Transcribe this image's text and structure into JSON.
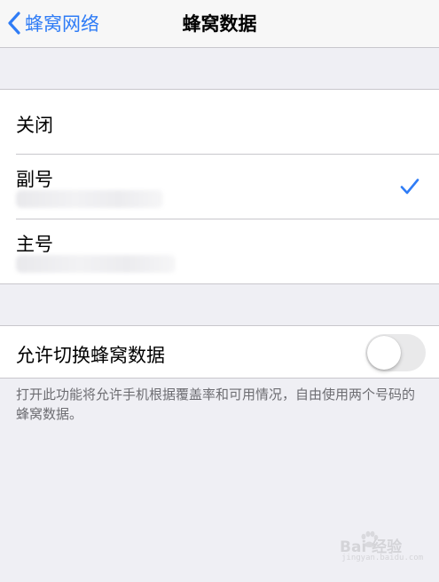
{
  "nav": {
    "back_label": "蜂窝网络",
    "title": "蜂窝数据"
  },
  "options": [
    {
      "label": "关闭",
      "selected": false
    },
    {
      "label": "副号",
      "selected": true
    },
    {
      "label": "主号",
      "selected": false
    }
  ],
  "toggle": {
    "label": "允许切换蜂窝数据",
    "on": false
  },
  "footnote": "打开此功能将允许手机根据覆盖率和可用情况，自由使用两个号码的蜂窝数据。",
  "watermark": {
    "text": "Bai 经验",
    "sub": "jingyan.baidu.com"
  },
  "colors": {
    "accent": "#2f7cf6",
    "background": "#efeff4",
    "separator": "#c8c7cc",
    "footnote": "#6d6d72"
  },
  "icons": {
    "back": "chevron-left-icon",
    "check": "checkmark-icon"
  }
}
